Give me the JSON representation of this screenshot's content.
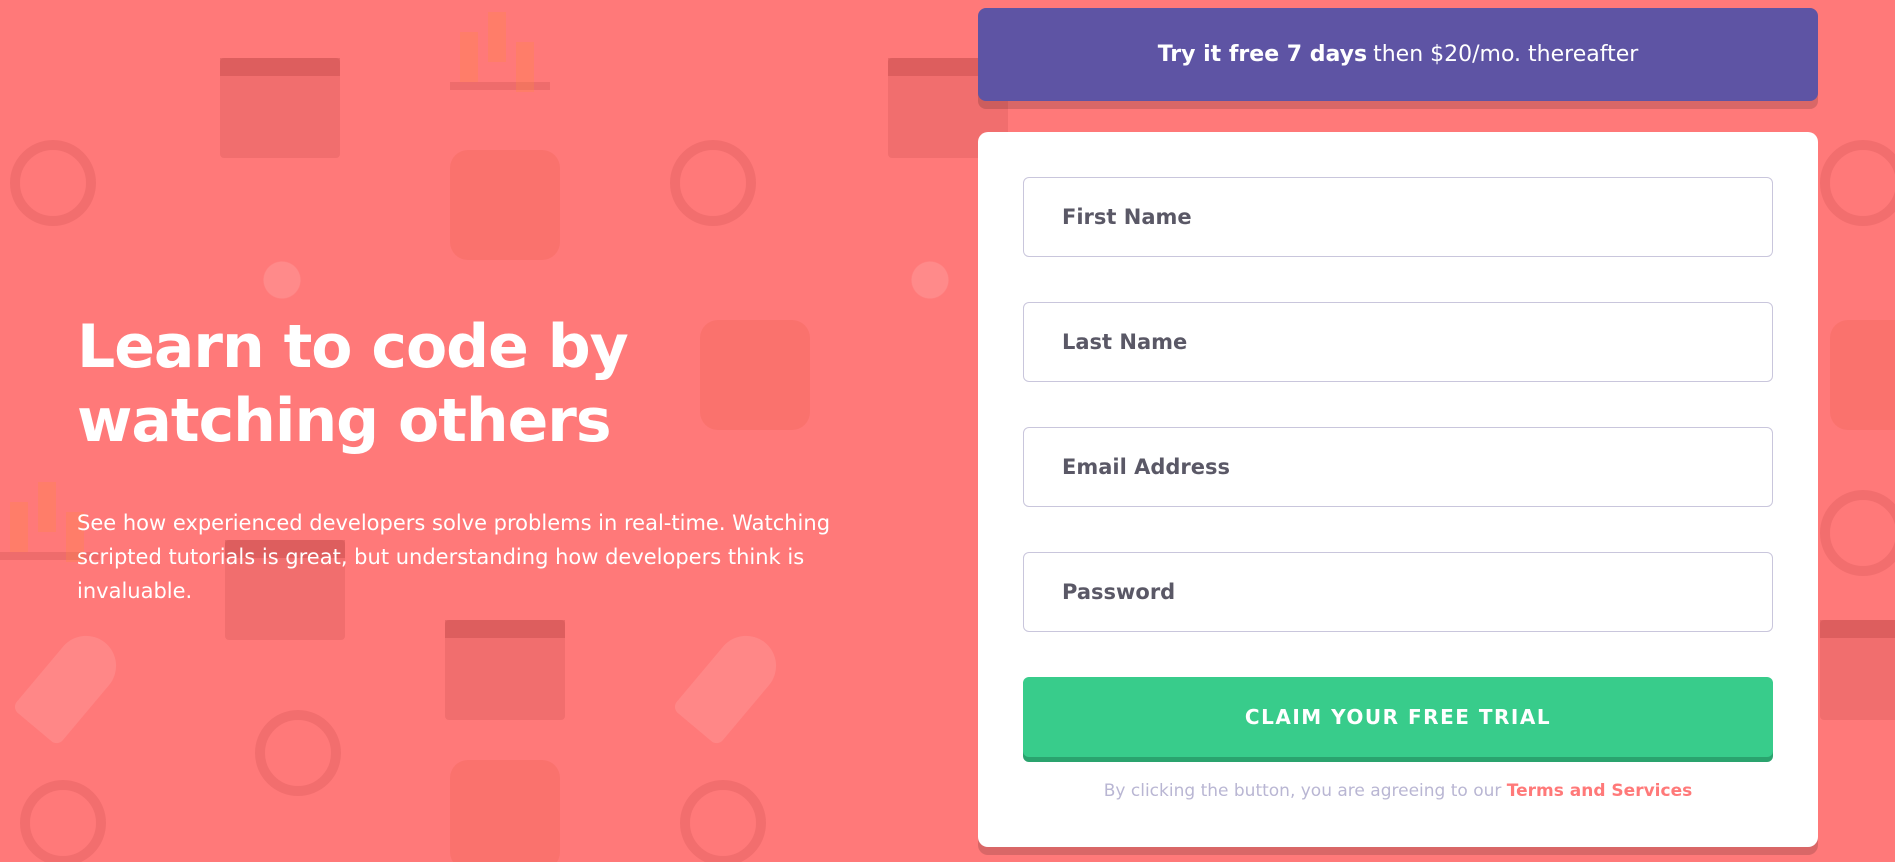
{
  "colors": {
    "background": "#ff7979",
    "promo_banner": "#5e54a4",
    "cta_button": "#38cc8b",
    "card": "#ffffff",
    "link": "#ff7979"
  },
  "hero": {
    "title_line1": "Learn to code by",
    "title_line2": "watching others",
    "description": "See how experienced developers solve problems in real-time. Watching scripted tutorials is great, but understanding how developers think is invaluable."
  },
  "promo": {
    "bold": "Try it free 7 days",
    "rest": "then $20/mo. thereafter"
  },
  "form": {
    "first_name_placeholder": "First Name",
    "last_name_placeholder": "Last Name",
    "email_placeholder": "Email Address",
    "password_placeholder": "Password",
    "submit_label": "CLAIM YOUR FREE TRIAL",
    "terms_prefix": "By clicking the button, you are agreeing to our",
    "terms_link": "Terms and Services"
  },
  "icons": [
    "headset-icon",
    "toolbox-icon",
    "window-icon",
    "network-hub-icon",
    "rocket-icon",
    "chart-icon",
    "magnifier-icon",
    "gear-icon",
    "globe-icon",
    "thumbs-up-icon"
  ]
}
